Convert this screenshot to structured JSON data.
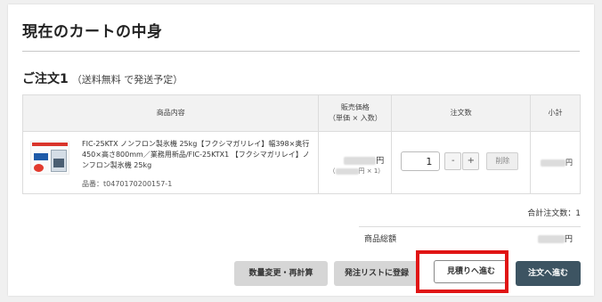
{
  "page_title": "現在のカートの中身",
  "order": {
    "heading": "ご注文1",
    "shipping_note": "（送料無料 で発送予定）"
  },
  "table": {
    "headers": {
      "item": "商品内容",
      "price": "販売価格",
      "price_sub": "（単価 × 入数）",
      "quantity": "注文数",
      "subtotal": "小計"
    },
    "rows": [
      {
        "name": "FIC-25KTX ノンフロン製氷機 25kg【フクシマガリレイ】幅398×奥行450×高さ800mm／業務用新品/FIC-25KTX1 【フクシマガリレイ】ノンフロン製氷機 25kg",
        "code_label": "品番：",
        "code": "t0470170200157-1",
        "price_suffix": "円",
        "unit_suffix": "円 × 1）",
        "unit_prefix": "（",
        "quantity": "1",
        "minus_label": "-",
        "plus_label": "+",
        "delete_label": "削除",
        "subtotal_suffix": "円"
      }
    ]
  },
  "summary": {
    "total_qty_label": "合計注文数：",
    "total_qty": "1",
    "total_label": "商品総額",
    "total_suffix": "円"
  },
  "buttons": {
    "recalc": "数量変更・再計算",
    "order_list": "発注リストに登録",
    "quote": "見積りへ進む",
    "checkout": "注文へ進む"
  },
  "colors": {
    "checkout_bg": "#3d5462",
    "highlight": "#e01414"
  }
}
